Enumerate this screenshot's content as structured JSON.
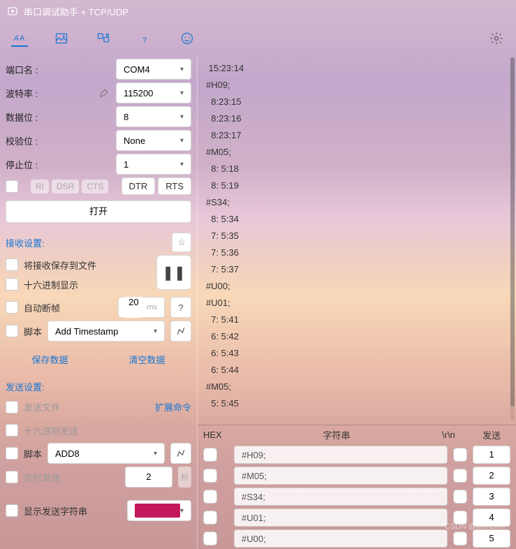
{
  "titlebar": {
    "title": "串口调试助手 + TCP/UDP"
  },
  "port": {
    "name_label": "端口名 :",
    "name_value": "COM4",
    "baud_label": "波特率 :",
    "baud_value": "115200",
    "databits_label": "数据位 :",
    "databits_value": "8",
    "parity_label": "校验位 :",
    "parity_value": "None",
    "stopbits_label": "停止位 :",
    "stopbits_value": "1",
    "ri": "RI",
    "dsr": "DSR",
    "cts": "CTS",
    "dtr": "DTR",
    "rts": "RTS",
    "open": "打开"
  },
  "recv": {
    "title": "接收设置:",
    "save_file": "将接收保存到文件",
    "hex_display": "十六进制显示",
    "auto_break": "自动断帧",
    "auto_break_ms": "20",
    "ms": "ms",
    "q": "?",
    "script": "脚本",
    "script_value": "Add Timestamp",
    "save_data": "保存数据",
    "clear_data": "清空数据"
  },
  "send": {
    "title": "发送设置:",
    "send_file": "发送文件",
    "ext_cmd": "扩展命令",
    "hex_send": "十六进制发送",
    "script": "脚本",
    "script_value": "ADD8",
    "timed_send": "定时发送",
    "timed_value": "2",
    "sec": "秒",
    "show_tx": "显示发送字符串"
  },
  "terminal": [
    " 15:23:14",
    "#H09;",
    "  8:23:15",
    "  8:23:16",
    "  8:23:17",
    "#M05;",
    "  8: 5:18",
    "  8: 5:19",
    "#S34;",
    "  8: 5:34",
    "  7: 5:35",
    "  7: 5:36",
    "  7: 5:37",
    "#U00;",
    "#U01;",
    "  7: 5:41",
    "  6: 5:42",
    "  6: 5:43",
    "  6: 5:44",
    "#M05;",
    "  5: 5:45"
  ],
  "send_table": {
    "hex": "HEX",
    "string": "字符串",
    "rn": "\\r\\n",
    "send": "发送",
    "rows": [
      {
        "text": "#H09;",
        "btn": "1"
      },
      {
        "text": "#M05;",
        "btn": "2"
      },
      {
        "text": "#S34;",
        "btn": "3"
      },
      {
        "text": "#U01;",
        "btn": "4"
      },
      {
        "text": "#U00;",
        "btn": "5"
      }
    ]
  },
  "watermark": "CSDN @wenchm"
}
